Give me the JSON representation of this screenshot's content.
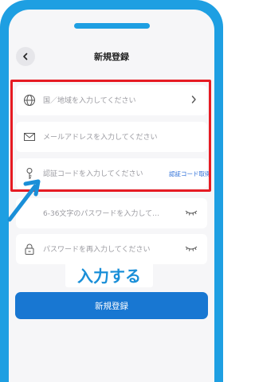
{
  "header": {
    "title": "新規登録"
  },
  "form": {
    "country_placeholder": "国／地域を入力してください",
    "email_placeholder": "メールアドレスを入力してください",
    "code_placeholder": "認証コードを入力してください",
    "get_code_label": "認証コード取得",
    "password_placeholder": "6-36文字のパスワードを入力して…",
    "confirm_password_placeholder": "パスワードを再入力してください"
  },
  "actions": {
    "submit_label": "新規登録"
  },
  "annotation": {
    "label": "入力する",
    "highlight_color": "#e61b23",
    "label_color": "#1a8fd8"
  },
  "colors": {
    "frame": "#1e9fe2",
    "primary_button": "#1877d2",
    "link": "#2b6ed8"
  },
  "icons": [
    "chevron-left-icon",
    "globe-icon",
    "chevron-right-icon",
    "envelope-icon",
    "key-icon",
    "eye-closed-icon",
    "lock-icon",
    "arrow-icon"
  ]
}
